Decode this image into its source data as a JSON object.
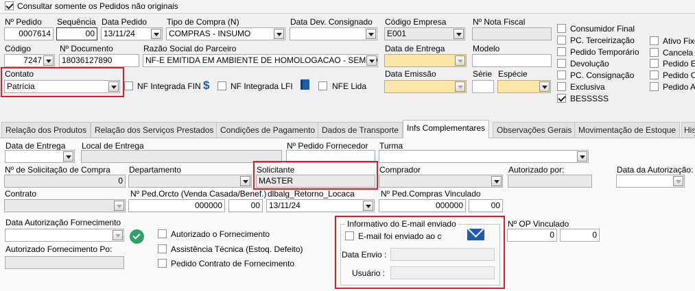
{
  "top": {
    "consultar_label": "Consultar somente os Pedidos não originais"
  },
  "header": {
    "n_pedido": {
      "label": "Nº Pedido",
      "value": "0007614"
    },
    "sequencia": {
      "label": "Sequência",
      "value": "00"
    },
    "data_pedido": {
      "label": "Data Pedido",
      "value": "13/11/24"
    },
    "tipo_compra": {
      "label": "Tipo de Compra (N)",
      "value": "COMPRAS - INSUMO"
    },
    "data_dev": {
      "label": "Data Dev. Consignado",
      "value": ""
    },
    "codigo_empresa": {
      "label": "Código Empresa",
      "value": "E001"
    },
    "nota_fiscal": {
      "label": "Nº Nota Fiscal",
      "value": ""
    },
    "codigo": {
      "label": "Código",
      "value": "7247"
    },
    "n_documento": {
      "label": "Nº Documento",
      "value": "18036127890"
    },
    "razao_social": {
      "label": "Razão Social do Parceiro",
      "value": "NF-E EMITIDA EM AMBIENTE DE HOMOLOGACAO - SEM VA"
    },
    "data_entrega": {
      "label": "Data de Entrega",
      "value": ""
    },
    "modelo": {
      "label": "Modelo",
      "value": ""
    },
    "contato": {
      "label": "Contato",
      "value": "Patrícia"
    },
    "nf_fin": "NF Integrada FIN",
    "nf_lfi": "NF Integrada LFI",
    "nfe_lida": "NFE Lida",
    "data_emissao": {
      "label": "Data Emissão",
      "value": ""
    },
    "serie": {
      "label": "Série",
      "value": ""
    },
    "especie": {
      "label": "Espécie",
      "value": ""
    }
  },
  "checks1": [
    "Consumidor Final",
    "PC. Terceirização",
    "Pedido Temporário",
    "Devolução",
    "PC. Consignação",
    "Exclusiva",
    "BESSSSS"
  ],
  "checks2": [
    "Ativo Fixo",
    "Cancela",
    "Pedido E",
    "Pedido C",
    "Pedido A"
  ],
  "tabs": [
    "Relação dos Produtos",
    "Relação dos Serviços Prestados",
    "Condições de Pagamento",
    "Dados de Transporte",
    "Infs Complementares",
    "Observações Gerais",
    "Movimentação de Estoque",
    "His"
  ],
  "panel": {
    "data_entrega": {
      "label": "Data de Entrega",
      "value": ""
    },
    "local_entrega": {
      "label": "Local de Entrega",
      "value": ""
    },
    "pedido_fornecedor": {
      "label": "Nº Pedido Fornecedor",
      "value": ""
    },
    "turma": {
      "label": "Turma",
      "value": ""
    },
    "solicitacao": {
      "label": "Nº de Solicitação de Compra",
      "value": "0"
    },
    "departamento": {
      "label": "Departamento",
      "value": ""
    },
    "solicitante": {
      "label": "Solicitante",
      "value": "MASTER"
    },
    "comprador": {
      "label": "Comprador",
      "value": ""
    },
    "autorizado_por": {
      "label": "Autorizado por:",
      "value": ""
    },
    "data_autorizacao": {
      "label": "Data da Autorização:",
      "value": ""
    },
    "contrato": {
      "label": "Contrato",
      "value": ""
    },
    "ped_orcto": {
      "label": "Nº Ped.Orcto (Venda Casada/Benef.)",
      "value": "000000",
      "value2": "00"
    },
    "retorno": {
      "label": "dlbalg_Retorno_Locaca",
      "value": "13/11/24"
    },
    "ped_compras": {
      "label": "Nº Ped.Compras Vinculado",
      "value": "000000",
      "value2": "00"
    },
    "data_aut_fornec": {
      "label": "Data Autorização Fornecimento",
      "value": ""
    },
    "aut_fornec_po": {
      "label": "Autorizado Fornecimento Po:",
      "value": ""
    },
    "chk_autorizado": "Autorizado o Fornecimento",
    "chk_assistencia": "Assistência Técnica (Estoq. Defeito)",
    "chk_contrato": "Pedido Contrato de Fornecimento",
    "email_group": {
      "title": "Informativo do E-mail enviado",
      "check": "E-mail foi enviado ao c",
      "data_envio": "Data Envio :",
      "usuario": "Usuário :"
    },
    "op_vinculado": {
      "label": "Nº OP Vinculado",
      "value": "0",
      "value2": "0"
    }
  },
  "colors": {
    "highlight": "#d32029",
    "yellow_field": "#fde6a8",
    "accent_blue": "#1f5ca8",
    "ok_green": "#2aa36b"
  }
}
